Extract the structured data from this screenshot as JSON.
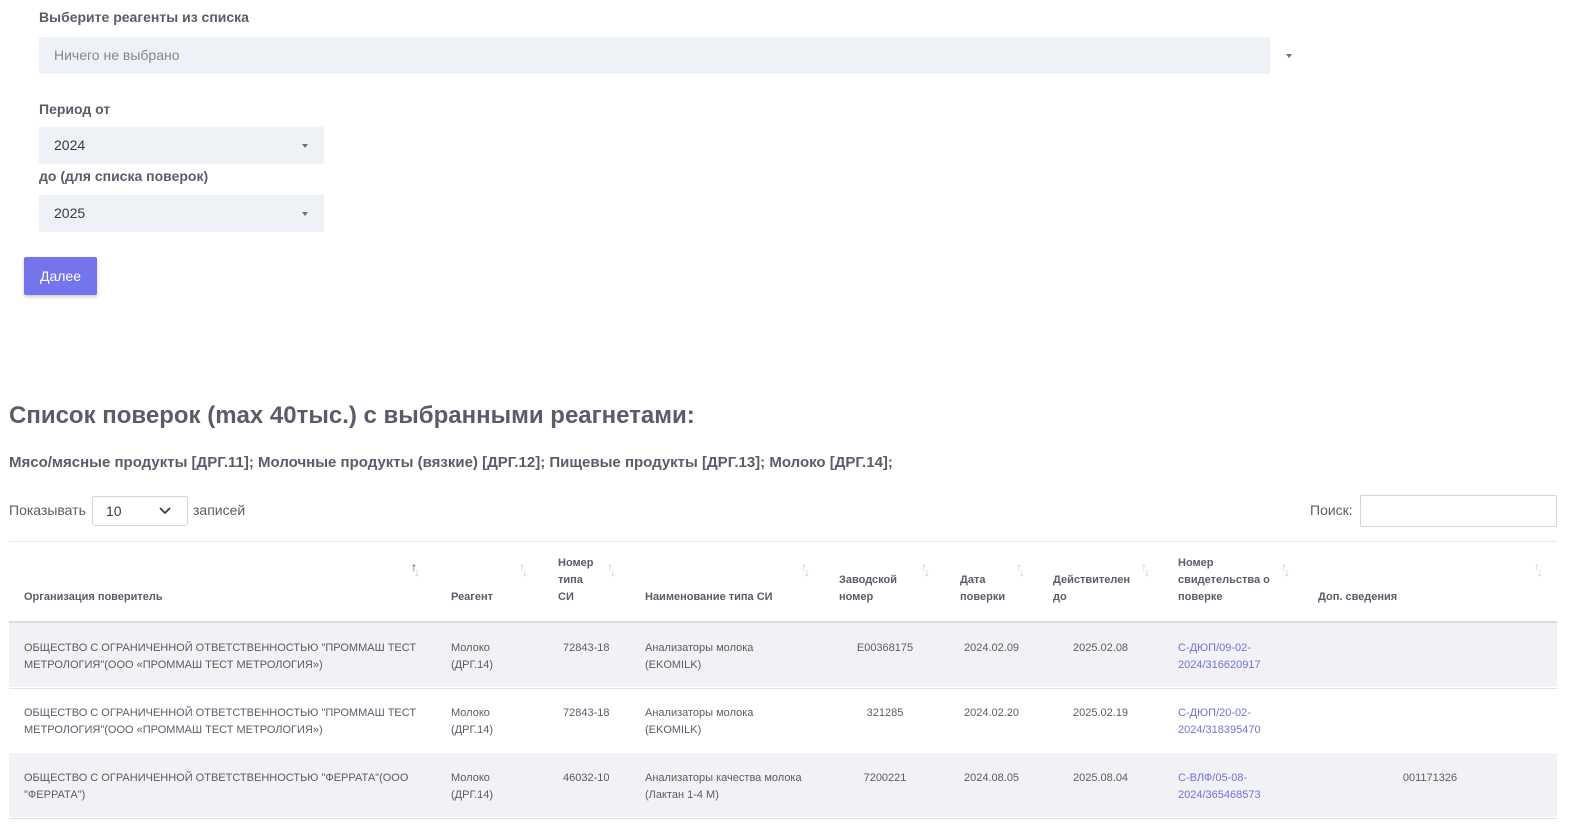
{
  "form": {
    "reagents_label": "Выберите реагенты из списка",
    "reagents_placeholder": "Ничего не выбрано",
    "period_from_label": "Период от",
    "period_from_value": "2024",
    "period_to_label": "до (для списка поверок)",
    "period_to_value": "2025",
    "next_button": "Далее"
  },
  "list": {
    "title": "Список поверок (max 40тыс.) с выбранными реагнетами:",
    "selected_reagents": "Мясо/мясные продукты [ДРГ.11]; Молочные продукты (вязкие) [ДРГ.12]; Пищевые продукты [ДРГ.13]; Молоко [ДРГ.14];"
  },
  "controls": {
    "show_label": "Показывать",
    "length_value": "10",
    "records_label": "записей",
    "search_label": "Поиск:"
  },
  "table": {
    "headers": [
      [
        "Организация поверитель"
      ],
      [
        "Реагент"
      ],
      [
        "Номер",
        "типа",
        "СИ"
      ],
      [
        "Наименование типа СИ"
      ],
      [
        "Заводской",
        "номер"
      ],
      [
        "Дата",
        "поверки"
      ],
      [
        "Действителен",
        "до"
      ],
      [
        "Номер",
        "свидетельства о",
        "поверке"
      ],
      [
        "Доп. сведения"
      ]
    ],
    "rows": [
      {
        "org": [
          "ОБЩЕСТВО С ОГРАНИЧЕННОЙ ОТВЕТСТВЕННОСТЬЮ \"ПРОММАШ ТЕСТ",
          "МЕТРОЛОГИЯ\"(ООО «ПРОММАШ ТЕСТ МЕТРОЛОГИЯ»)"
        ],
        "reagent": [
          "Молоко",
          "(ДРГ.14)"
        ],
        "type_no": "72843-18",
        "type_name": [
          "Анализаторы молока",
          "(EKOMILK)"
        ],
        "serial": "E00368175",
        "date": "2024.02.09",
        "valid": "2025.02.08",
        "cert": [
          "С-ДЮП/09-02-",
          "2024/316620917"
        ],
        "extra": ""
      },
      {
        "org": [
          "ОБЩЕСТВО С ОГРАНИЧЕННОЙ ОТВЕТСТВЕННОСТЬЮ \"ПРОММАШ ТЕСТ",
          "МЕТРОЛОГИЯ\"(ООО «ПРОММАШ ТЕСТ МЕТРОЛОГИЯ»)"
        ],
        "reagent": [
          "Молоко",
          "(ДРГ.14)"
        ],
        "type_no": "72843-18",
        "type_name": [
          "Анализаторы молока",
          "(EKOMILK)"
        ],
        "serial": "321285",
        "date": "2024.02.20",
        "valid": "2025.02.19",
        "cert": [
          "С-ДЮП/20-02-",
          "2024/318395470"
        ],
        "extra": ""
      },
      {
        "org": [
          "ОБЩЕСТВО С ОГРАНИЧЕННОЙ ОТВЕТСТВЕННОСТЬЮ \"ФЕРРАТА\"(ООО",
          "\"ФЕРРАТА\")"
        ],
        "reagent": [
          "Молоко",
          "(ДРГ.14)"
        ],
        "type_no": "46032-10",
        "type_name": [
          "Анализаторы качества молока",
          "(Лактан 1-4 М)"
        ],
        "serial": "7200221",
        "date": "2024.08.05",
        "valid": "2025.08.04",
        "cert": [
          "С-ВЛФ/05-08-",
          "2024/365468573"
        ],
        "extra": "001171326"
      }
    ]
  }
}
